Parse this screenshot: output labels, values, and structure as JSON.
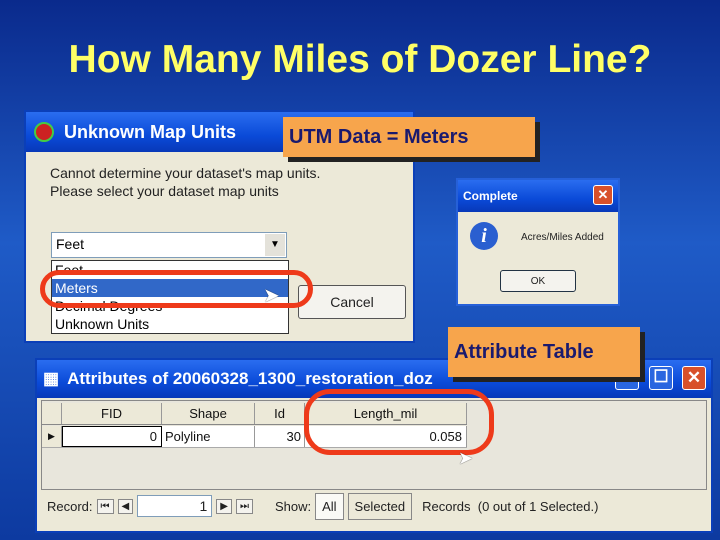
{
  "slide": {
    "title": "How Many Miles of Dozer Line?"
  },
  "units_dialog": {
    "title": "Unknown Map Units",
    "message_1": "Cannot determine your dataset's map units.",
    "message_2": "Please select your dataset map units",
    "selected": "Feet",
    "options": [
      "Feet",
      "Meters",
      "Decimal Degrees",
      "Unknown Units"
    ],
    "highlighted": "Meters",
    "cancel": "Cancel"
  },
  "callouts": {
    "utm": "UTM Data = Meters",
    "attr": "Attribute Table"
  },
  "complete_dialog": {
    "title": "Complete",
    "message": "Acres/Miles Added",
    "ok": "OK"
  },
  "attr_window": {
    "title": "Attributes of 20060328_1300_restoration_doz",
    "columns": [
      "FID",
      "Shape",
      "Id",
      "Length_mil"
    ],
    "row": [
      "0",
      "Polyline",
      "30",
      "0.058"
    ],
    "record_label": "Record:",
    "record_value": "1",
    "show_label": "Show:",
    "all": "All",
    "selected": "Selected",
    "status": "Records  (0 out of 1 Selected.)"
  },
  "colors": {
    "accent": "#ee3a1a",
    "callout": "#f7a54c",
    "title": "#ffff66"
  }
}
